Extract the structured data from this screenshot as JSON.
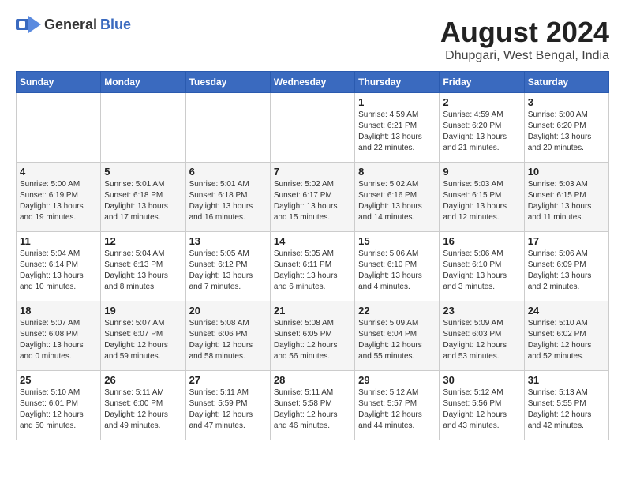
{
  "header": {
    "logo_general": "General",
    "logo_blue": "Blue",
    "month_year": "August 2024",
    "location": "Dhupgari, West Bengal, India"
  },
  "weekdays": [
    "Sunday",
    "Monday",
    "Tuesday",
    "Wednesday",
    "Thursday",
    "Friday",
    "Saturday"
  ],
  "weeks": [
    [
      {
        "day": "",
        "info": ""
      },
      {
        "day": "",
        "info": ""
      },
      {
        "day": "",
        "info": ""
      },
      {
        "day": "",
        "info": ""
      },
      {
        "day": "1",
        "info": "Sunrise: 4:59 AM\nSunset: 6:21 PM\nDaylight: 13 hours\nand 22 minutes."
      },
      {
        "day": "2",
        "info": "Sunrise: 4:59 AM\nSunset: 6:20 PM\nDaylight: 13 hours\nand 21 minutes."
      },
      {
        "day": "3",
        "info": "Sunrise: 5:00 AM\nSunset: 6:20 PM\nDaylight: 13 hours\nand 20 minutes."
      }
    ],
    [
      {
        "day": "4",
        "info": "Sunrise: 5:00 AM\nSunset: 6:19 PM\nDaylight: 13 hours\nand 19 minutes."
      },
      {
        "day": "5",
        "info": "Sunrise: 5:01 AM\nSunset: 6:18 PM\nDaylight: 13 hours\nand 17 minutes."
      },
      {
        "day": "6",
        "info": "Sunrise: 5:01 AM\nSunset: 6:18 PM\nDaylight: 13 hours\nand 16 minutes."
      },
      {
        "day": "7",
        "info": "Sunrise: 5:02 AM\nSunset: 6:17 PM\nDaylight: 13 hours\nand 15 minutes."
      },
      {
        "day": "8",
        "info": "Sunrise: 5:02 AM\nSunset: 6:16 PM\nDaylight: 13 hours\nand 14 minutes."
      },
      {
        "day": "9",
        "info": "Sunrise: 5:03 AM\nSunset: 6:15 PM\nDaylight: 13 hours\nand 12 minutes."
      },
      {
        "day": "10",
        "info": "Sunrise: 5:03 AM\nSunset: 6:15 PM\nDaylight: 13 hours\nand 11 minutes."
      }
    ],
    [
      {
        "day": "11",
        "info": "Sunrise: 5:04 AM\nSunset: 6:14 PM\nDaylight: 13 hours\nand 10 minutes."
      },
      {
        "day": "12",
        "info": "Sunrise: 5:04 AM\nSunset: 6:13 PM\nDaylight: 13 hours\nand 8 minutes."
      },
      {
        "day": "13",
        "info": "Sunrise: 5:05 AM\nSunset: 6:12 PM\nDaylight: 13 hours\nand 7 minutes."
      },
      {
        "day": "14",
        "info": "Sunrise: 5:05 AM\nSunset: 6:11 PM\nDaylight: 13 hours\nand 6 minutes."
      },
      {
        "day": "15",
        "info": "Sunrise: 5:06 AM\nSunset: 6:10 PM\nDaylight: 13 hours\nand 4 minutes."
      },
      {
        "day": "16",
        "info": "Sunrise: 5:06 AM\nSunset: 6:10 PM\nDaylight: 13 hours\nand 3 minutes."
      },
      {
        "day": "17",
        "info": "Sunrise: 5:06 AM\nSunset: 6:09 PM\nDaylight: 13 hours\nand 2 minutes."
      }
    ],
    [
      {
        "day": "18",
        "info": "Sunrise: 5:07 AM\nSunset: 6:08 PM\nDaylight: 13 hours\nand 0 minutes."
      },
      {
        "day": "19",
        "info": "Sunrise: 5:07 AM\nSunset: 6:07 PM\nDaylight: 12 hours\nand 59 minutes."
      },
      {
        "day": "20",
        "info": "Sunrise: 5:08 AM\nSunset: 6:06 PM\nDaylight: 12 hours\nand 58 minutes."
      },
      {
        "day": "21",
        "info": "Sunrise: 5:08 AM\nSunset: 6:05 PM\nDaylight: 12 hours\nand 56 minutes."
      },
      {
        "day": "22",
        "info": "Sunrise: 5:09 AM\nSunset: 6:04 PM\nDaylight: 12 hours\nand 55 minutes."
      },
      {
        "day": "23",
        "info": "Sunrise: 5:09 AM\nSunset: 6:03 PM\nDaylight: 12 hours\nand 53 minutes."
      },
      {
        "day": "24",
        "info": "Sunrise: 5:10 AM\nSunset: 6:02 PM\nDaylight: 12 hours\nand 52 minutes."
      }
    ],
    [
      {
        "day": "25",
        "info": "Sunrise: 5:10 AM\nSunset: 6:01 PM\nDaylight: 12 hours\nand 50 minutes."
      },
      {
        "day": "26",
        "info": "Sunrise: 5:11 AM\nSunset: 6:00 PM\nDaylight: 12 hours\nand 49 minutes."
      },
      {
        "day": "27",
        "info": "Sunrise: 5:11 AM\nSunset: 5:59 PM\nDaylight: 12 hours\nand 47 minutes."
      },
      {
        "day": "28",
        "info": "Sunrise: 5:11 AM\nSunset: 5:58 PM\nDaylight: 12 hours\nand 46 minutes."
      },
      {
        "day": "29",
        "info": "Sunrise: 5:12 AM\nSunset: 5:57 PM\nDaylight: 12 hours\nand 44 minutes."
      },
      {
        "day": "30",
        "info": "Sunrise: 5:12 AM\nSunset: 5:56 PM\nDaylight: 12 hours\nand 43 minutes."
      },
      {
        "day": "31",
        "info": "Sunrise: 5:13 AM\nSunset: 5:55 PM\nDaylight: 12 hours\nand 42 minutes."
      }
    ]
  ]
}
